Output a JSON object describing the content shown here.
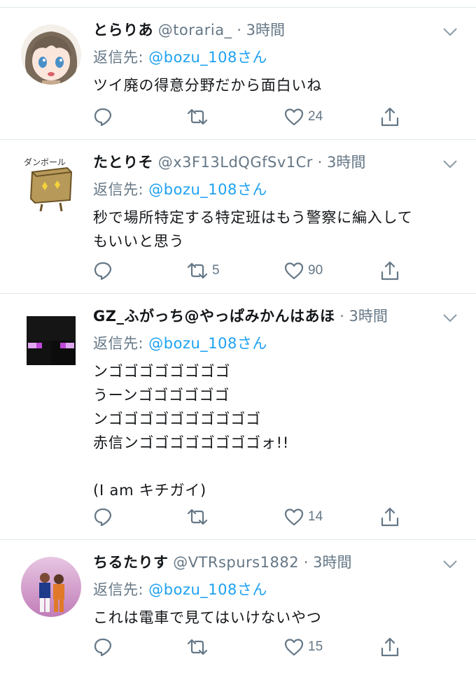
{
  "tweets": [
    {
      "display_name": "とらりあ",
      "handle": "@toraria_",
      "time": "3時間",
      "reply_prefix": "返信先: ",
      "reply_to": "@bozu_108さん",
      "body": "ツイ廃の得意分野だから面白いね",
      "retweets": "",
      "likes": "24",
      "avatar_icon": "anime-girl-avatar-icon"
    },
    {
      "display_name": "たとりそ",
      "handle": "@x3F13LdQGfSv1Cr",
      "time": "3時間",
      "reply_prefix": "返信先: ",
      "reply_to": "@bozu_108さん",
      "body": "秒で場所特定する特定班はもう警察に編入して\nもいいと思う",
      "retweets": "5",
      "likes": "90",
      "avatar_icon": "cardboard-box-avatar-icon",
      "avatar_text": "ダンボール"
    },
    {
      "display_name": "GZ_ふがっち@やっぱみかんはあほ",
      "handle": "",
      "time": "3時間",
      "reply_prefix": "返信先: ",
      "reply_to": "@bozu_108さん",
      "body": "ンゴゴゴゴゴゴゴゴ\nうーンゴゴゴゴゴゴ\nンゴゴゴゴゴゴゴゴゴゴ\n赤信ンゴゴゴゴゴゴゴゴォ!!\n\n(I am キチガイ)",
      "retweets": "",
      "likes": "14",
      "avatar_icon": "pixel-enderman-avatar-icon"
    },
    {
      "display_name": "ちるたりす",
      "handle": "@VTRspurs1882",
      "time": "3時間",
      "reply_prefix": "返信先: ",
      "reply_to": "@bozu_108さん",
      "body": "これは電車で見てはいけないやつ",
      "retweets": "",
      "likes": "15",
      "avatar_icon": "soccer-players-avatar-icon"
    }
  ],
  "colors": {
    "text": "#14171a",
    "secondary": "#657786",
    "link": "#1da1f2",
    "divider": "#e1e8ed"
  }
}
